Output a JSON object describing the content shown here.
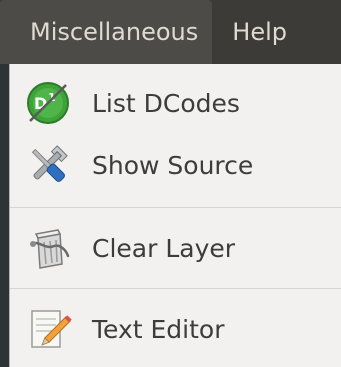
{
  "menubar": {
    "items": [
      {
        "label": "Miscellaneous",
        "active": true
      },
      {
        "label": "Help",
        "active": false
      }
    ]
  },
  "dropdown": {
    "items": [
      {
        "label": "List DCodes",
        "icon": "dcode-icon"
      },
      {
        "label": "Show Source",
        "icon": "tools-icon"
      },
      {
        "label": "Clear Layer",
        "icon": "clear-layer-icon"
      },
      {
        "label": "Text Editor",
        "icon": "text-editor-icon"
      }
    ]
  },
  "colors": {
    "menubar_bg": "#3c3b37",
    "menubar_active_bg": "#4c4b47",
    "menubar_text": "#dfdbd2",
    "dropdown_bg": "#f2f1f0",
    "item_text": "#3c3c3c",
    "dcode_green": "#3fa33a"
  }
}
